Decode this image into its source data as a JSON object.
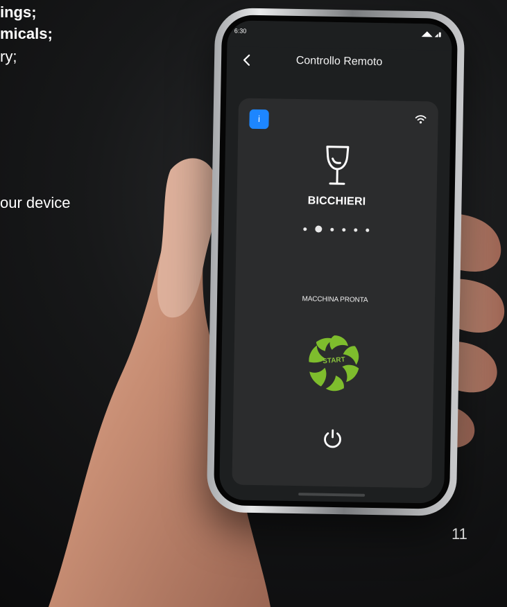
{
  "slide": {
    "line1": "ings;",
    "line2": "micals;",
    "line3": "ry;",
    "line4": "our device",
    "page_number": "11"
  },
  "phone": {
    "status_time": "6:30",
    "header_title": "Controllo Remoto",
    "mode_label": "BICCHIERI",
    "status_text": "MACCHINA PRONTA",
    "start_label": "START",
    "info_label": "i",
    "active_step": 2,
    "step_count": 6,
    "accent_blue": "#1d86ff",
    "accent_green": "#7ebd2d",
    "icons": {
      "back": "chevron-left-icon",
      "wifi": "wifi-icon",
      "glass": "wine-glass-icon",
      "power": "power-icon",
      "start": "start-swirl-icon"
    }
  }
}
